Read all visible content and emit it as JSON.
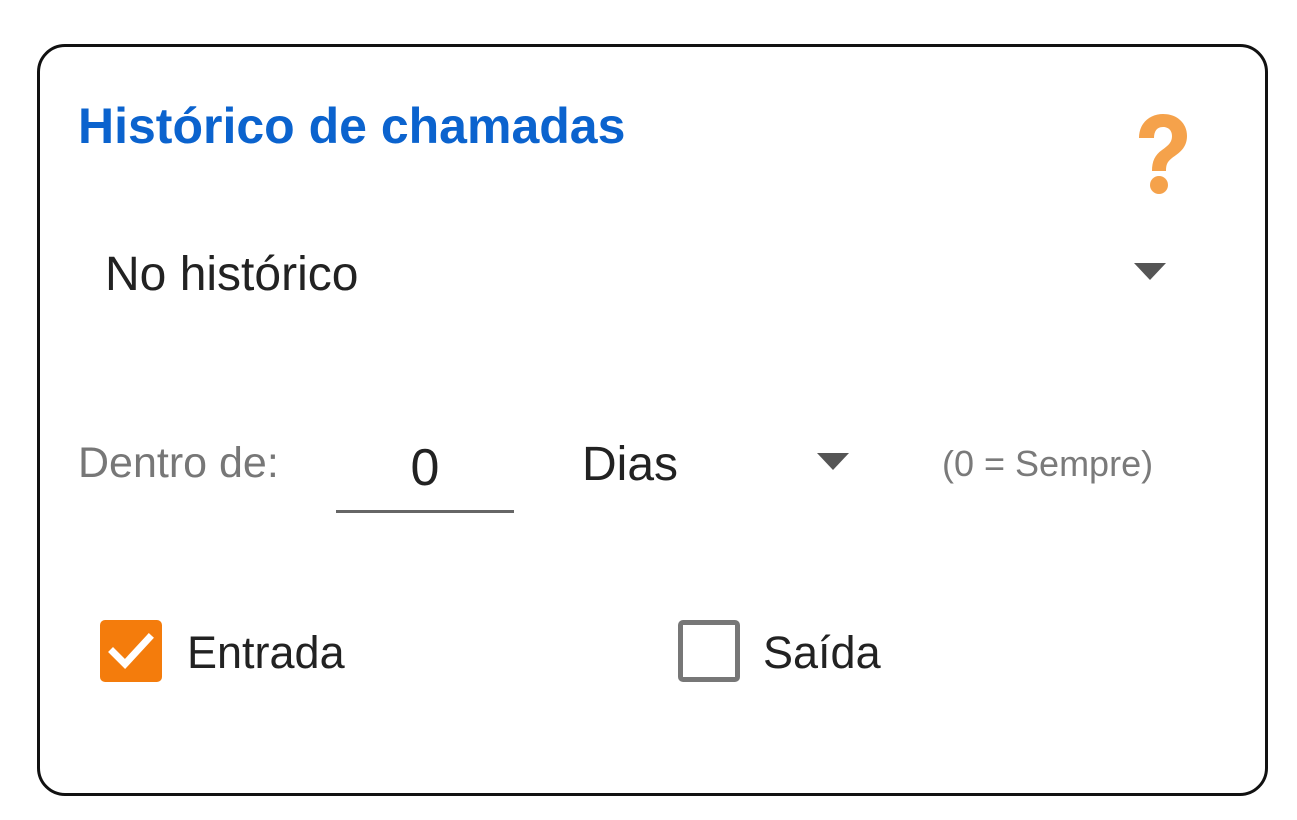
{
  "colors": {
    "title": "#0b63ce",
    "help_icon": "#f5a24b",
    "checkbox_checked": "#f47c0c",
    "checkbox_unchecked_border": "#777777"
  },
  "card": {
    "title": "Histórico de chamadas",
    "help_icon": "question-mark-icon"
  },
  "history_select": {
    "value": "No histórico"
  },
  "within": {
    "label": "Dentro de:",
    "value": "0",
    "unit": "Dias",
    "hint": "(0 = Sempre)"
  },
  "checkboxes": [
    {
      "label": "Entrada",
      "checked": true
    },
    {
      "label": "Saída",
      "checked": false
    }
  ]
}
